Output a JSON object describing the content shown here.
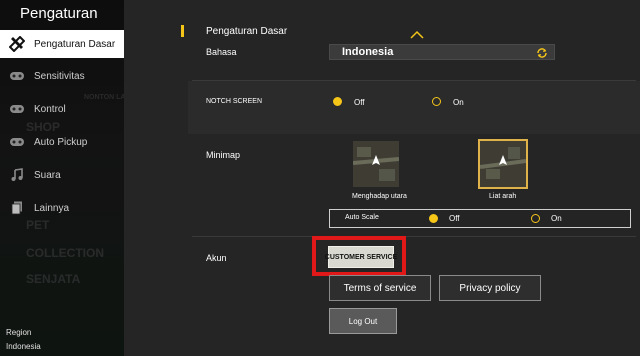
{
  "sidebar": {
    "title": "Pengaturan",
    "items": [
      {
        "label": "Pengaturan Dasar",
        "icon": "tools-icon",
        "active": true
      },
      {
        "label": "Sensitivitas",
        "icon": "gamepad-icon",
        "active": false
      },
      {
        "label": "Kontrol",
        "icon": "gamepad-icon",
        "active": false
      },
      {
        "label": "Auto Pickup",
        "icon": "gamepad-icon",
        "active": false
      },
      {
        "label": "Suara",
        "icon": "music-icon",
        "active": false
      },
      {
        "label": "Lainnya",
        "icon": "document-icon",
        "active": false
      }
    ],
    "region_label": "Region",
    "region_value": "Indonesia"
  },
  "section": {
    "title": "Pengaturan Dasar"
  },
  "language": {
    "label": "Bahasa",
    "value": "Indonesia"
  },
  "notch": {
    "label": "NOTCH SCREEN",
    "options": [
      "Off",
      "On"
    ],
    "selected": "Off"
  },
  "minimap": {
    "label": "Minimap",
    "options": [
      "Menghadap utara",
      "Liat arah"
    ],
    "selected": "Liat arah",
    "auto_scale": {
      "label": "Auto Scale",
      "options": [
        "Off",
        "On"
      ],
      "selected": "Off"
    }
  },
  "account": {
    "label": "Akun",
    "customer_service": "CUSTOMER SERVICE",
    "terms": "Terms of service",
    "privacy": "Privacy policy",
    "logout": "Log Out"
  },
  "colors": {
    "accent": "#f5c518",
    "highlight": "#e01818"
  }
}
